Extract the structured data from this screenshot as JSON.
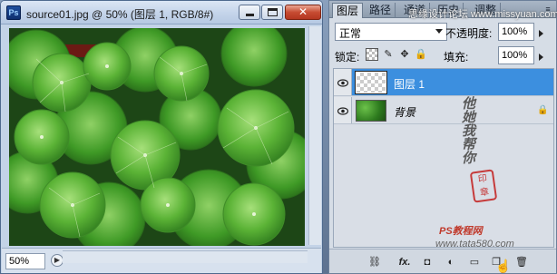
{
  "document": {
    "app_badge": "Ps",
    "title": "source01.jpg @ 50% (图层 1, RGB/8#)",
    "zoom": "50%",
    "window_buttons": {
      "minimize_icon": "minimize-icon",
      "maximize_icon": "maximize-icon",
      "close_label": "✕"
    }
  },
  "panel": {
    "tabs": [
      {
        "label": "图层",
        "active": true
      },
      {
        "label": "路径",
        "active": false
      },
      {
        "label": "通道",
        "active": false
      },
      {
        "label": "历史",
        "active": false
      },
      {
        "label": "调整",
        "active": false
      }
    ],
    "menu_glyph": "≡",
    "blend_mode": "正常",
    "opacity_label": "不透明度:",
    "opacity_value": "100%",
    "lock_label": "锁定:",
    "lock_icons": [
      "lock-transparent-icon",
      "brush-icon",
      "move-icon",
      "lock-icon"
    ],
    "fill_label": "填充:",
    "fill_value": "100%",
    "layers": [
      {
        "name": "图层 1",
        "selected": true,
        "thumbnail": "transparent",
        "visible": true,
        "locked": false
      },
      {
        "name": "背景",
        "selected": false,
        "thumbnail": "leaves",
        "visible": true,
        "locked": true
      }
    ],
    "bottom_icons": [
      "link-icon",
      "fx-icon",
      "mask-icon",
      "adjustment-icon",
      "folder-icon",
      "new-layer-icon",
      "trash-icon"
    ],
    "bottom_labels": {
      "fx": "fx."
    }
  },
  "watermarks": {
    "top": "思缘设计论坛 www.missyuan.com",
    "handwriting": "他她我帮你",
    "site": "PS教程网",
    "url": "www.tata580.com"
  },
  "colors": {
    "selected_layer": "#3c8fdf",
    "close_button": "#c74c32",
    "panel_bg": "#d6dde6",
    "title_bar": "#c4d4ea"
  }
}
